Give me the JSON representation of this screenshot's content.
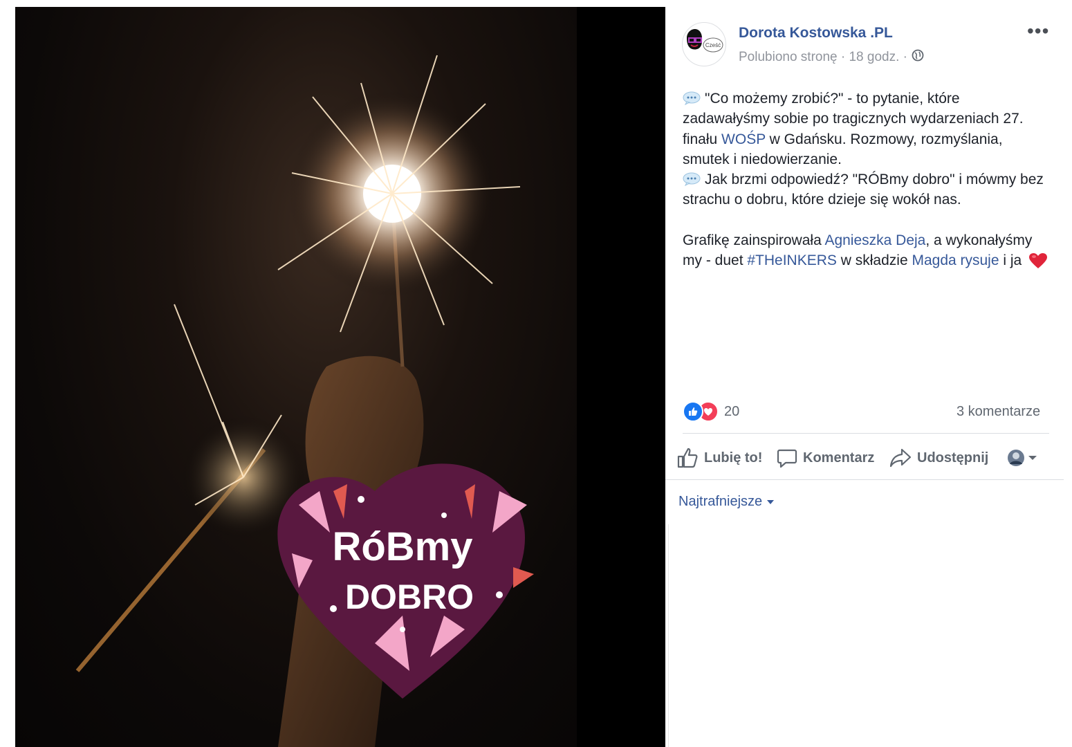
{
  "image": {
    "heart_text_line1": "RóBmy",
    "heart_text_line2": "DOBRO"
  },
  "post": {
    "author": "Dorota Kostowska .PL",
    "avatar_caption": "Cześć",
    "meta_text": "Polubiono stronę · 18 godz. ·",
    "more_label": "•••",
    "paragraph1": {
      "t1": "\"Co możemy zrobić?\" - to pytanie, które zadawałyśmy sobie po tragicznych wydarzeniach 27. finału ",
      "link_wosp": "WOŚP",
      "t2": " w Gdańsku. Rozmowy, rozmyślania, smutek i niedowierzanie."
    },
    "paragraph2": "Jak brzmi odpowiedź? \"RÓBmy dobro\" i mówmy bez strachu o dobru, które dzieje się wokół nas.",
    "paragraph3": {
      "t1": "Grafikę zainspirowała ",
      "link_agnieszka": "Agnieszka Deja",
      "t2": ", a wykonałyśmy my - duet ",
      "link_hashtag": "#THeINKERS",
      "t3": " w składzie ",
      "link_magda": "Magda rysuje",
      "t4": " i ja"
    }
  },
  "stats": {
    "reactions_count": "20",
    "comments_count": "3 komentarze"
  },
  "actions": {
    "like": "Lubię to!",
    "comment": "Komentarz",
    "share": "Udostępnij"
  },
  "sort": {
    "label": "Najtrafniejsze"
  },
  "colors": {
    "link": "#365899",
    "secondary_text": "#90949c",
    "like_blue": "#1877f2",
    "love_red": "#f33e58",
    "heart_purple": "#5a1840"
  },
  "icons": {
    "globe": "globe-icon",
    "like": "thumbs-up-icon",
    "comment": "speech-bubble-icon",
    "share": "share-arrow-icon",
    "heart_emoji": "red-heart-icon",
    "speech_emoji": "speech-balloon-icon"
  }
}
